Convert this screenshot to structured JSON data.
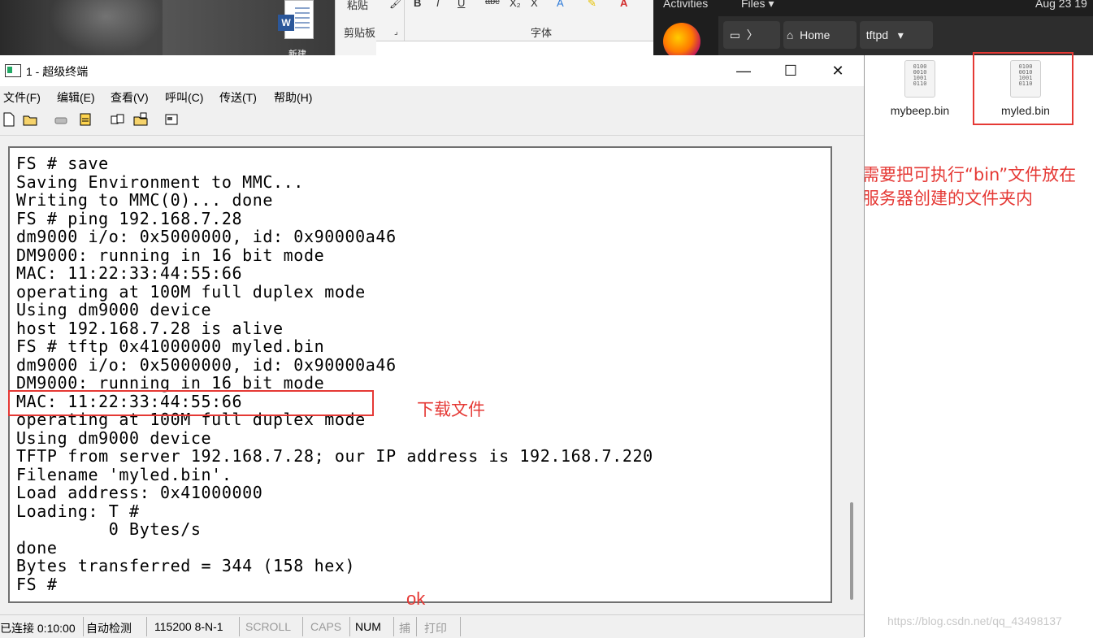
{
  "background": {
    "word_shortcut_label": "新建",
    "word_badge": "W",
    "ribbon": {
      "group_clipboard": "剪贴板",
      "group_font": "字体",
      "group_top": "粘贴",
      "format_glyphs": [
        "B",
        "I",
        "U",
        "abc",
        "X₂",
        "X"
      ]
    },
    "ubuntu": {
      "activities": "Activities",
      "files_menu": "Files",
      "clock": "Aug 23 19",
      "path_home": "Home",
      "path_current": "tftpd"
    }
  },
  "file_manager": {
    "files": [
      {
        "name": "mybeep.bin",
        "icon": "binary-file-icon"
      },
      {
        "name": "myled.bin",
        "icon": "binary-file-icon",
        "highlighted": true
      }
    ],
    "annotation": "需要把可执行“bin”文件放在服务器创建的文件夹内"
  },
  "terminal_window": {
    "title": "1 - 超级终端",
    "menu": [
      "文件(F)",
      "编辑(E)",
      "查看(V)",
      "呼叫(C)",
      "传送(T)",
      "帮助(H)"
    ],
    "controls": {
      "minimize": "—",
      "maximize": "☐",
      "close": "✕"
    },
    "lines": [
      "FS # save",
      "Saving Environment to MMC...",
      "Writing to MMC(0)... done",
      "FS # ping 192.168.7.28",
      "dm9000 i/o: 0x5000000, id: 0x90000a46",
      "DM9000: running in 16 bit mode",
      "MAC: 11:22:33:44:55:66",
      "operating at 100M full duplex mode",
      "Using dm9000 device",
      "host 192.168.7.28 is alive",
      "FS # tftp 0x41000000 myled.bin",
      "dm9000 i/o: 0x5000000, id: 0x90000a46",
      "DM9000: running in 16 bit mode",
      "MAC: 11:22:33:44:55:66",
      "operating at 100M full duplex mode",
      "Using dm9000 device",
      "TFTP from server 192.168.7.28; our IP address is 192.168.7.220",
      "Filename 'myled.bin'.",
      "Load address: 0x41000000",
      "Loading: T #",
      "         0 Bytes/s",
      "done",
      "Bytes transferred = 344 (158 hex)",
      "FS #"
    ],
    "annotation_download": "下载文件",
    "annotation_ok": "ok",
    "status": {
      "connected": "已连接 0:10:00",
      "detect": "自动检测",
      "port": "115200 8-N-1",
      "scroll": "SCROLL",
      "caps": "CAPS",
      "num": "NUM",
      "capture": "捕",
      "print": "打印"
    }
  },
  "watermark": "https://blog.csdn.net/qq_43498137",
  "colors": {
    "annotation": "#e53935",
    "terminal_bg": "#ffffff",
    "chrome": "#f0f0f0"
  }
}
